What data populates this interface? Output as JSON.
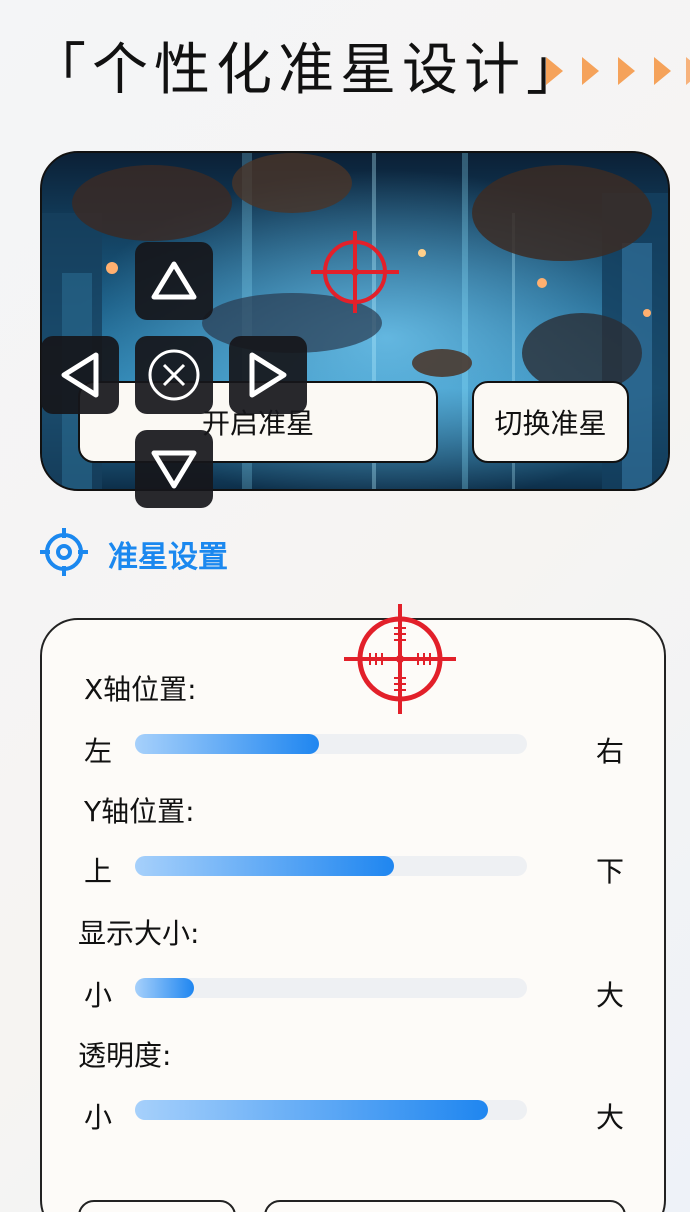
{
  "page": {
    "title": "「个性化准星设计」"
  },
  "colors": {
    "accent": "#1b88ef",
    "arrow": "#f5a25a",
    "crosshair": "#e2202a",
    "slider_fill": "#1f86f0"
  },
  "preview": {
    "open_button_label": "开启准星",
    "switch_button_label": "切换准星",
    "dpad": {
      "up_icon": "triangle-up-icon",
      "down_icon": "triangle-down-icon",
      "left_icon": "triangle-left-icon",
      "right_icon": "triangle-right-icon",
      "center_icon": "circle-x-icon"
    }
  },
  "settings": {
    "title": "准星设置",
    "icon": "crosshair-icon",
    "sliders": [
      {
        "label": "X轴位置:",
        "min_label": "左",
        "max_label": "右",
        "value": 0.47
      },
      {
        "label": "Y轴位置:",
        "min_label": "上",
        "max_label": "下",
        "value": 0.66
      },
      {
        "label": "显示大小:",
        "min_label": "小",
        "max_label": "大",
        "value": 0.15
      },
      {
        "label": "透明度:",
        "min_label": "小",
        "max_label": "大",
        "value": 0.9
      }
    ]
  }
}
